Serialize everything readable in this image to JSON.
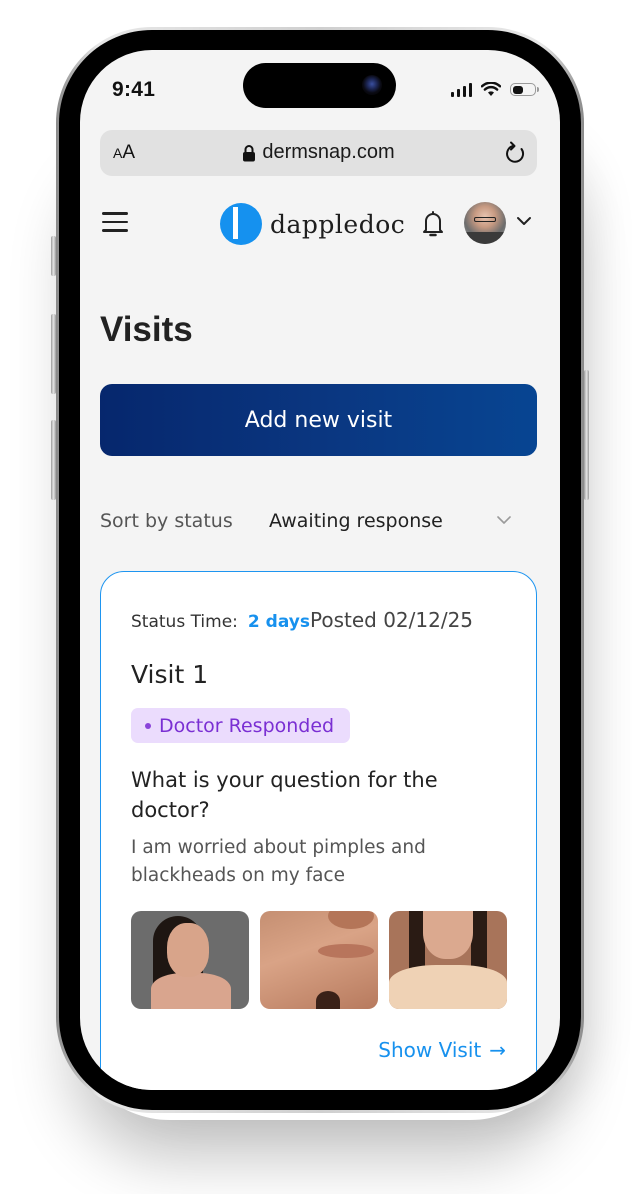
{
  "status_bar": {
    "time": "9:41",
    "battery_level": 0.5
  },
  "browser": {
    "text_size_label_small": "A",
    "text_size_label_large": "A",
    "url": "dermsnap.com",
    "icons": {
      "lock": "lock-icon",
      "reload": "reload-icon"
    }
  },
  "nav": {
    "brand": "dappledoc",
    "icons": {
      "menu": "hamburger-icon",
      "notifications": "bell-icon",
      "account": "chevron-down-icon"
    }
  },
  "page": {
    "title": "Visits",
    "add_button_label": "Add new visit",
    "sort_label": "Sort by status",
    "sort_selected": "Awaiting response"
  },
  "visits": [
    {
      "status_time_label": "Status Time:",
      "status_time_value": "2 days",
      "posted": "Posted 02/12/25",
      "title": "Visit 1",
      "status_badge": "Doctor Responded",
      "question_label": "What is your question for the doctor?",
      "question_answer": "I am worried about pimples and blackheads on my face",
      "photos": [
        "face-profile-photo",
        "cheek-closeup-photo",
        "front-face-photo"
      ],
      "show_link": "Show Visit",
      "show_link_icon": "→"
    }
  ],
  "colors": {
    "accent_blue": "#1791ee",
    "primary_navy": "#0a3680",
    "badge_bg": "#ebdcfd",
    "badge_text": "#7a2fd3"
  }
}
